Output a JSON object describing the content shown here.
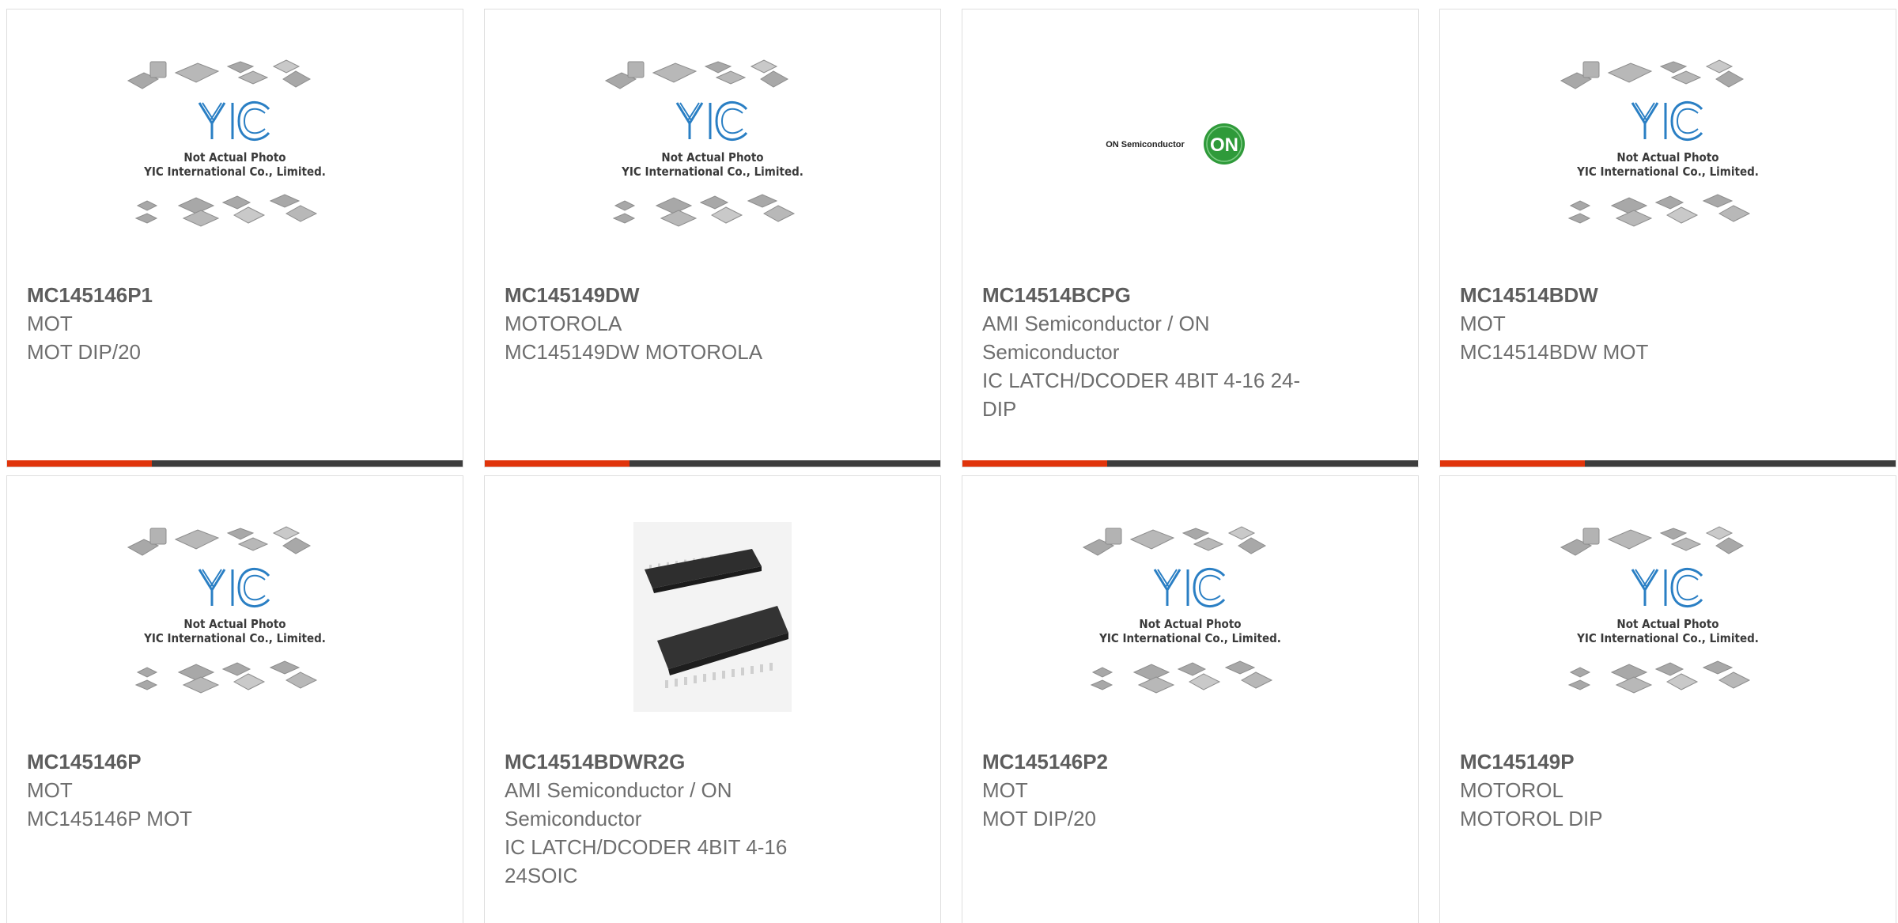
{
  "products": [
    {
      "part_number": "MC145146P1",
      "manufacturer": "MOT",
      "description": "MOT DIP/20",
      "image": "yic-placeholder",
      "placeholder_line1": "Not Actual Photo",
      "placeholder_line2": "YIC International Co., Limited."
    },
    {
      "part_number": "MC145149DW",
      "manufacturer": "MOTOROLA",
      "description": "MC145149DW MOTOROLA",
      "image": "yic-placeholder",
      "placeholder_line1": "Not Actual Photo",
      "placeholder_line2": "YIC International Co., Limited."
    },
    {
      "part_number": "MC14514BCPG",
      "manufacturer": "AMI Semiconductor / ON Semiconductor",
      "description": "IC LATCH/DCODER 4BIT 4-16 24-DIP",
      "image": "on-semiconductor-logo",
      "logo_text": "ON Semiconductor",
      "logo_badge": "ON"
    },
    {
      "part_number": "MC14514BDW",
      "manufacturer": "MOT",
      "description": "MC14514BDW MOT",
      "image": "yic-placeholder",
      "placeholder_line1": "Not Actual Photo",
      "placeholder_line2": "YIC International Co., Limited."
    },
    {
      "part_number": "MC145146P",
      "manufacturer": "MOT",
      "description": "MC145146P MOT",
      "image": "yic-placeholder",
      "placeholder_line1": "Not Actual Photo",
      "placeholder_line2": "YIC International Co., Limited."
    },
    {
      "part_number": "MC14514BDWR2G",
      "manufacturer": "AMI Semiconductor / ON Semiconductor",
      "description": "IC LATCH/DCODER 4BIT 4-16 24SOIC",
      "image": "soic-chip-photo"
    },
    {
      "part_number": "MC145146P2",
      "manufacturer": "MOT",
      "description": "MOT DIP/20",
      "image": "yic-placeholder",
      "placeholder_line1": "Not Actual Photo",
      "placeholder_line2": "YIC International Co., Limited."
    },
    {
      "part_number": "MC145149P",
      "manufacturer": "MOTOROL",
      "description": "MOTOROL DIP",
      "image": "yic-placeholder",
      "placeholder_line1": "Not Actual Photo",
      "placeholder_line2": "YIC International Co., Limited."
    }
  ],
  "colors": {
    "accent": "#e0340b",
    "bar": "#3d3d3d",
    "yic_blue": "#2a7fc4",
    "on_green": "#2f9a3a"
  }
}
